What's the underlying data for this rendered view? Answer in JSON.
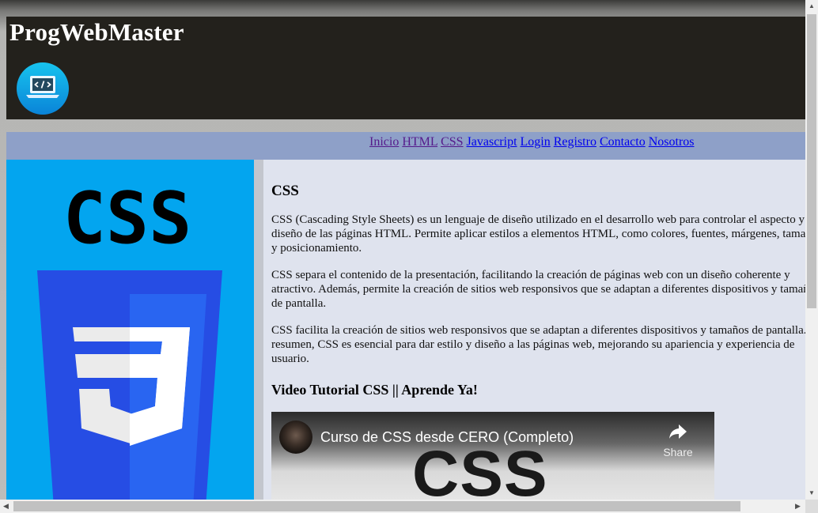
{
  "header": {
    "site_title": "ProgWebMaster",
    "logo_icon": "code-laptop-icon"
  },
  "nav": {
    "links": [
      {
        "label": "Inicio",
        "visited": true
      },
      {
        "label": "HTML",
        "visited": true
      },
      {
        "label": "CSS",
        "visited": true
      },
      {
        "label": "Javascript",
        "visited": false
      },
      {
        "label": "Login",
        "visited": false
      },
      {
        "label": "Registro",
        "visited": false
      },
      {
        "label": "Contacto",
        "visited": false
      },
      {
        "label": "Nosotros",
        "visited": false
      }
    ]
  },
  "side_image": {
    "icon": "css3-logo-icon",
    "text": "CSS"
  },
  "content": {
    "heading": "CSS",
    "paragraphs": [
      "CSS (Cascading Style Sheets) es un lenguaje de diseño utilizado en el desarrollo web para controlar el aspecto y diseño de las páginas HTML. Permite aplicar estilos a elementos HTML, como colores, fuentes, márgenes, tamaños y posicionamiento.",
      "CSS separa el contenido de la presentación, facilitando la creación de páginas web con un diseño coherente y atractivo. Además, permite la creación de sitios web responsivos que se adaptan a diferentes dispositivos y tamaños de pantalla.",
      "CSS facilita la creación de sitios web responsivos que se adaptan a diferentes dispositivos y tamaños de pantalla. En resumen, CSS es esencial para dar estilo y diseño a las páginas web, mejorando su apariencia y experiencia de usuario."
    ],
    "video_heading": "Video Tutorial CSS || Aprende Ya!",
    "video": {
      "title": "Curso de CSS desde CERO (Completo)",
      "share_label": "Share",
      "thumbnail_text": "CSS"
    }
  },
  "colors": {
    "header_bg": "#23211c",
    "nav_bg": "#8ea0c8",
    "content_bg": "#dfe3ee",
    "side_bg": "#03a5ef"
  }
}
